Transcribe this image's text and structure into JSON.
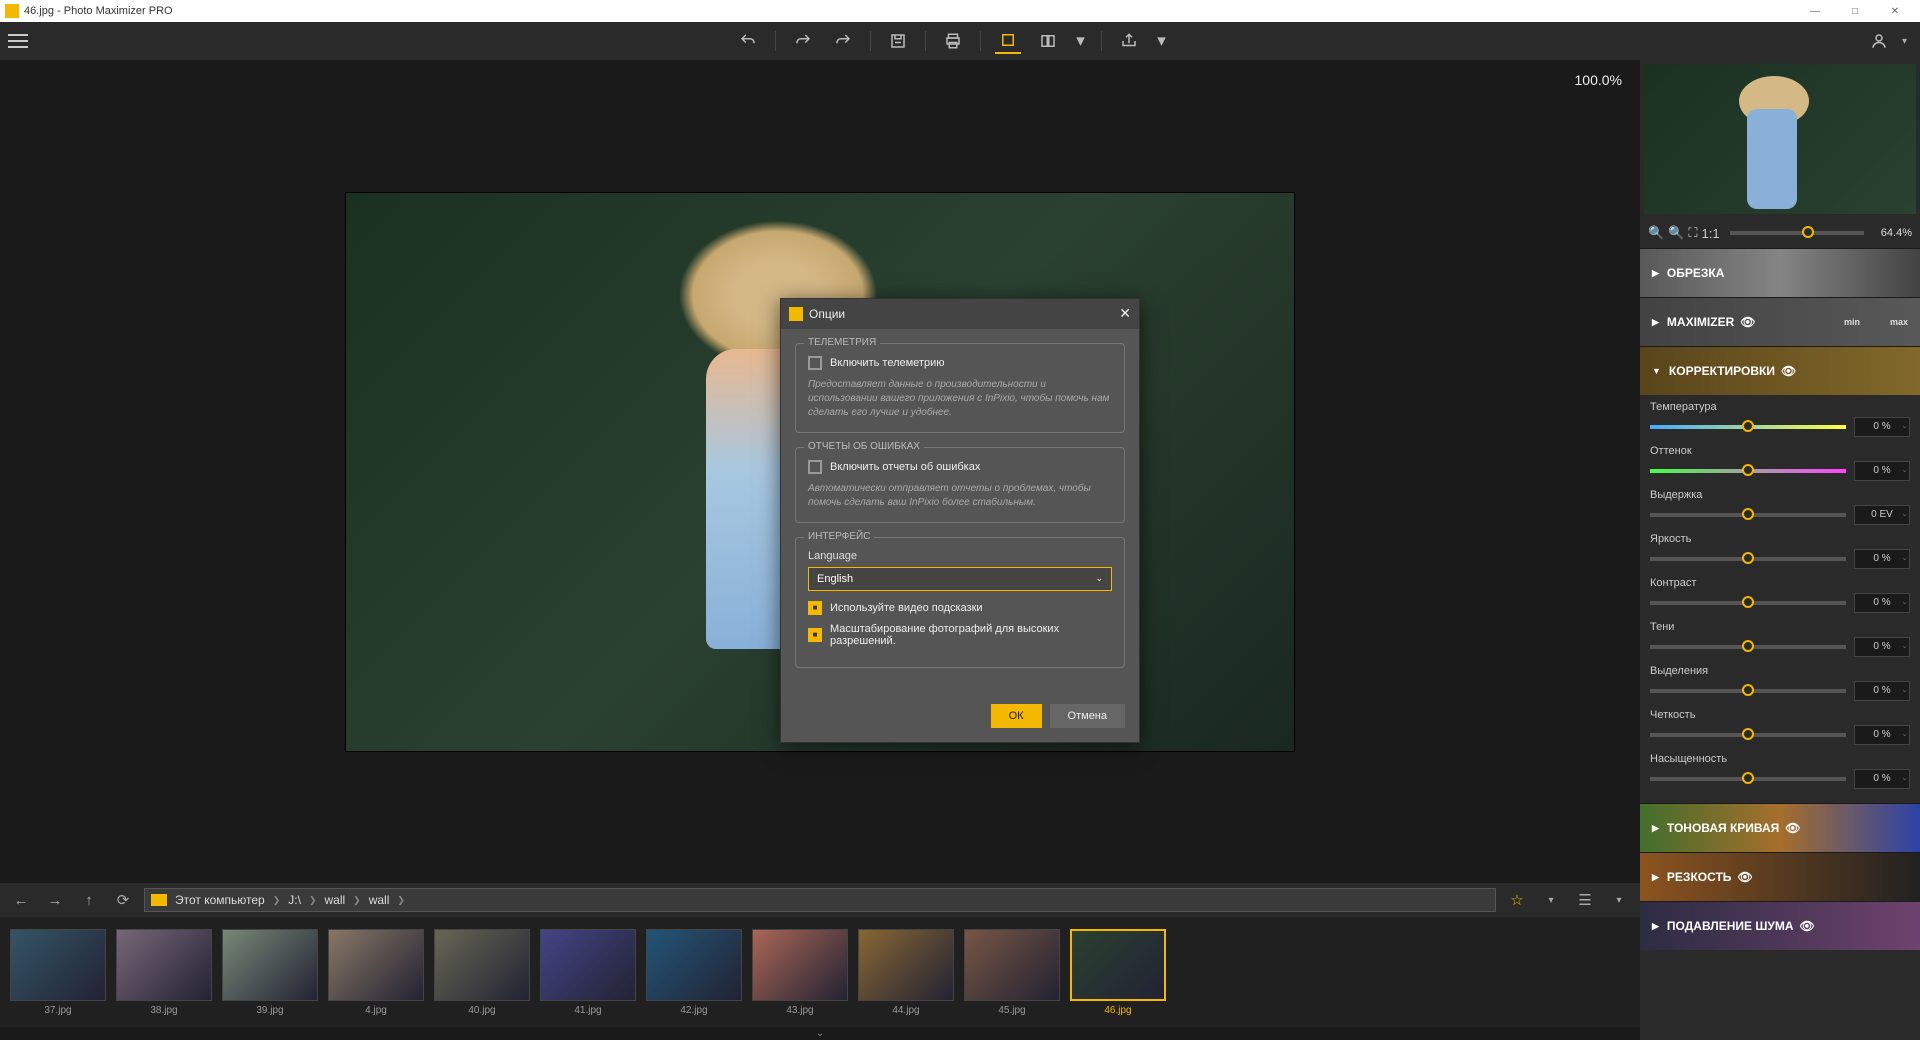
{
  "titlebar": {
    "filename": "46.jpg",
    "appname": "Photo Maximizer PRO"
  },
  "viewer": {
    "zoom": "100.0%"
  },
  "breadcrumb": {
    "root": "Этот компьютер",
    "drive": "J:\\",
    "folder1": "wall",
    "folder2": "wall"
  },
  "thumbnails": [
    {
      "label": "37.jpg"
    },
    {
      "label": "38.jpg"
    },
    {
      "label": "39.jpg"
    },
    {
      "label": "4.jpg"
    },
    {
      "label": "40.jpg"
    },
    {
      "label": "41.jpg"
    },
    {
      "label": "42.jpg"
    },
    {
      "label": "43.jpg"
    },
    {
      "label": "44.jpg"
    },
    {
      "label": "45.jpg"
    },
    {
      "label": "46.jpg"
    }
  ],
  "preview": {
    "zoom_pct": "64.4%"
  },
  "panels": {
    "crop": "ОБРЕЗКА",
    "maximizer": "MAXIMIZER",
    "min": "min",
    "max": "max",
    "adjustments": "КОРРЕКТИРОВКИ",
    "tonecurve": "ТОНОВАЯ КРИВАЯ",
    "sharpness": "РЕЗКОСТЬ",
    "noise": "ПОДАВЛЕНИЕ ШУМА"
  },
  "adjustments": [
    {
      "label": "Температура",
      "value": "0 %",
      "class": "temp"
    },
    {
      "label": "Оттенок",
      "value": "0 %",
      "class": "tint"
    },
    {
      "label": "Выдержка",
      "value": "0 EV",
      "class": ""
    },
    {
      "label": "Яркость",
      "value": "0 %",
      "class": ""
    },
    {
      "label": "Контраст",
      "value": "0 %",
      "class": ""
    },
    {
      "label": "Тени",
      "value": "0 %",
      "class": ""
    },
    {
      "label": "Выделения",
      "value": "0 %",
      "class": ""
    },
    {
      "label": "Четкость",
      "value": "0 %",
      "class": ""
    },
    {
      "label": "Насыщенность",
      "value": "0 %",
      "class": ""
    }
  ],
  "dialog": {
    "title": "Опции",
    "telemetry": {
      "legend": "ТЕЛЕМЕТРИЯ",
      "checkbox": "Включить телеметрию",
      "help": "Предоставляет данные о производительности и использовании вашего приложения с InPixio, чтобы помочь нам сделать его лучше и удобнее."
    },
    "errors": {
      "legend": "ОТЧЕТЫ ОБ ОШИБКАХ",
      "checkbox": "Включить отчеты об ошибках",
      "help": "Автоматически отправляет отчеты о проблемах, чтобы помочь сделать ваш InPixio более стабильным."
    },
    "interface": {
      "legend": "ИНТЕРФЕЙС",
      "lang_label": "Language",
      "lang_value": "English",
      "tips": "Используйте видео подсказки",
      "scaling": "Масштабирование фотографий для высоких разрешений."
    },
    "ok": "ОК",
    "cancel": "Отмена"
  }
}
